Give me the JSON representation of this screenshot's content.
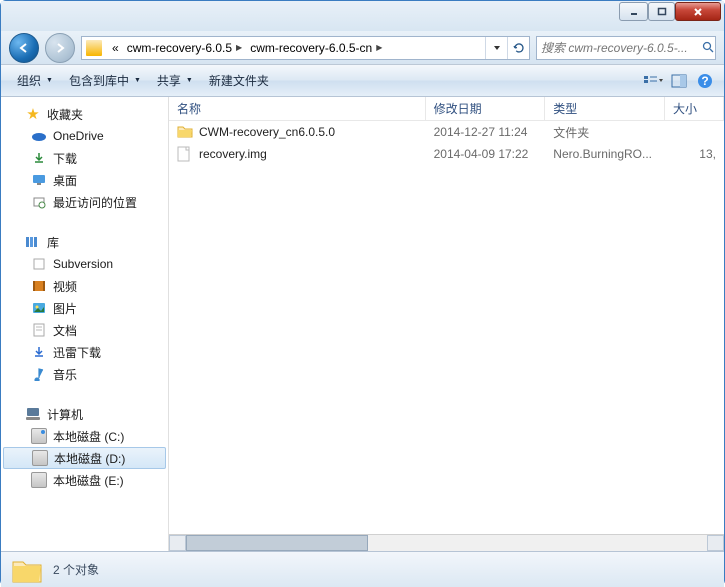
{
  "breadcrumbs": {
    "prefix": "«",
    "items": [
      "cwm-recovery-6.0.5",
      "cwm-recovery-6.0.5-cn"
    ]
  },
  "search": {
    "placeholder": "搜索 cwm-recovery-6.0.5-..."
  },
  "toolbar": {
    "organize": "组织",
    "include": "包含到库中",
    "share": "共享",
    "newfolder": "新建文件夹"
  },
  "columns": {
    "name": "名称",
    "date": "修改日期",
    "type": "类型",
    "size": "大小"
  },
  "col_widths": {
    "name": 262,
    "date": 122,
    "type": 122,
    "size": 60
  },
  "files": [
    {
      "icon": "folder",
      "name": "CWM-recovery_cn6.0.5.0",
      "date": "2014-12-27 11:24",
      "type": "文件夹",
      "size": ""
    },
    {
      "icon": "file",
      "name": "recovery.img",
      "date": "2014-04-09 17:22",
      "type": "Nero.BurningRO...",
      "size": "13,"
    }
  ],
  "sidebar": {
    "favorites": {
      "label": "收藏夹",
      "items": [
        {
          "icon": "onedrive",
          "label": "OneDrive"
        },
        {
          "icon": "download",
          "label": "下载"
        },
        {
          "icon": "desktop",
          "label": "桌面"
        },
        {
          "icon": "recent",
          "label": "最近访问的位置"
        }
      ]
    },
    "libraries": {
      "label": "库",
      "items": [
        {
          "icon": "svn",
          "label": "Subversion"
        },
        {
          "icon": "video",
          "label": "视频"
        },
        {
          "icon": "picture",
          "label": "图片"
        },
        {
          "icon": "doc",
          "label": "文档"
        },
        {
          "icon": "xunlei",
          "label": "迅雷下载"
        },
        {
          "icon": "music",
          "label": "音乐"
        }
      ]
    },
    "computer": {
      "label": "计算机",
      "items": [
        {
          "icon": "drive-c",
          "label": "本地磁盘 (C:)",
          "selected": false
        },
        {
          "icon": "drive",
          "label": "本地磁盘 (D:)",
          "selected": true
        },
        {
          "icon": "drive",
          "label": "本地磁盘 (E:)",
          "selected": false
        }
      ]
    }
  },
  "status": {
    "text": "2 个对象"
  }
}
